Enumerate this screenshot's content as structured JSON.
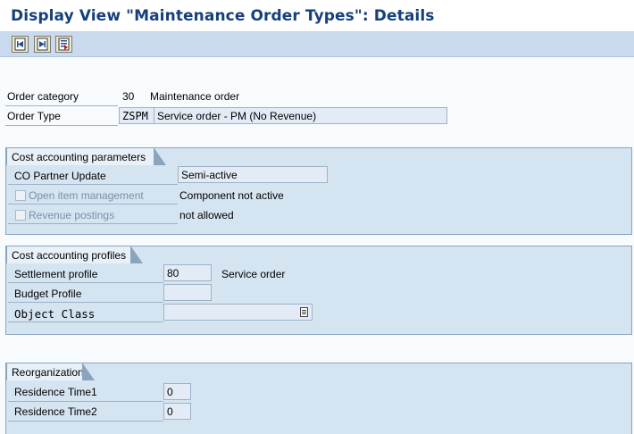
{
  "window": {
    "title": "Display View \"Maintenance Order Types\": Details"
  },
  "toolbar": {
    "buttons": [
      "previous-entry-icon",
      "next-entry-icon",
      "other-entry-icon"
    ]
  },
  "header": {
    "order_category_label": "Order category",
    "order_category_value": "30",
    "order_category_text": "Maintenance order",
    "order_type_label": "Order Type",
    "order_type_value": "ZSPM",
    "order_type_text": "Service order - PM (No Revenue)"
  },
  "cost_params": {
    "title": "Cost accounting parameters",
    "co_partner_label": "CO Partner Update",
    "co_partner_value": "Semi-active",
    "open_item_label": "Open item management",
    "open_item_text": "Component not active",
    "revenue_label": "Revenue postings",
    "revenue_text": "not allowed"
  },
  "cost_profiles": {
    "title": "Cost accounting profiles",
    "settlement_label": "Settlement profile",
    "settlement_value": "80",
    "settlement_text": "Service order",
    "budget_label": "Budget Profile",
    "budget_value": "",
    "object_class_label": "Object Class",
    "object_class_value": ""
  },
  "reorg": {
    "title": "Reorganization",
    "residence1_label": "Residence Time1",
    "residence1_value": "0",
    "residence2_label": "Residence Time2",
    "residence2_value": "0"
  },
  "colors": {
    "title": "#16407a",
    "toolbar": "#c9d9ee",
    "group": "#d5e4f1"
  }
}
